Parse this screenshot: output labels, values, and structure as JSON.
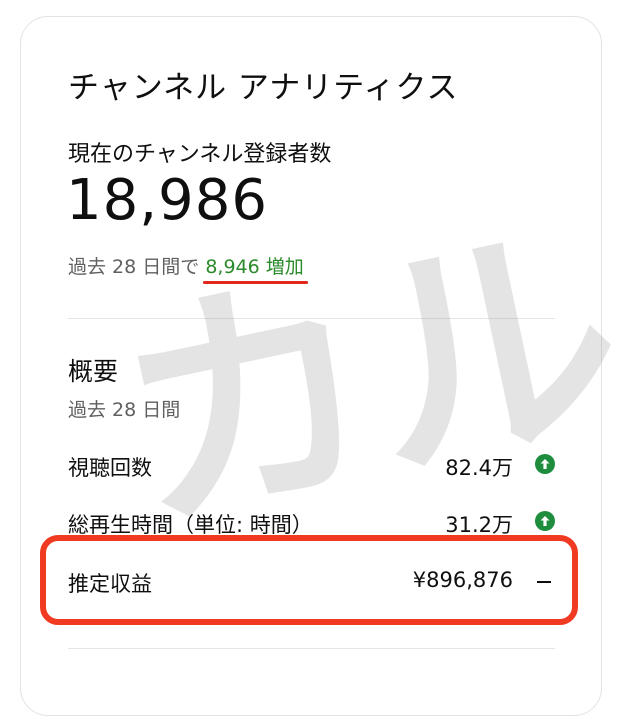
{
  "card": {
    "title": "チャンネル アナリティクス",
    "subscribers_label": "現在のチャンネル登録者数",
    "subscribers_count": "18,986",
    "period_prefix": "過去 28 日間で",
    "period_increase": "8,946 増加"
  },
  "overview": {
    "title": "概要",
    "period": "過去 28 日間",
    "metrics": [
      {
        "label": "視聴回数",
        "value": "82.4万",
        "trend": "up"
      },
      {
        "label": "総再生時間（単位: 時間）",
        "value": "31.2万",
        "trend": "up"
      },
      {
        "label": "推定収益",
        "value": "¥896,876",
        "trend": "none"
      }
    ]
  },
  "watermark": "カル",
  "colors": {
    "increase_text": "#2b8a2b",
    "trend_up": "#1e8e3e",
    "highlight_border": "#f13a22",
    "underline": "#e0291b"
  },
  "icons": {
    "trend_up": "arrow-up-circle-icon",
    "no_change": "dash-icon"
  }
}
